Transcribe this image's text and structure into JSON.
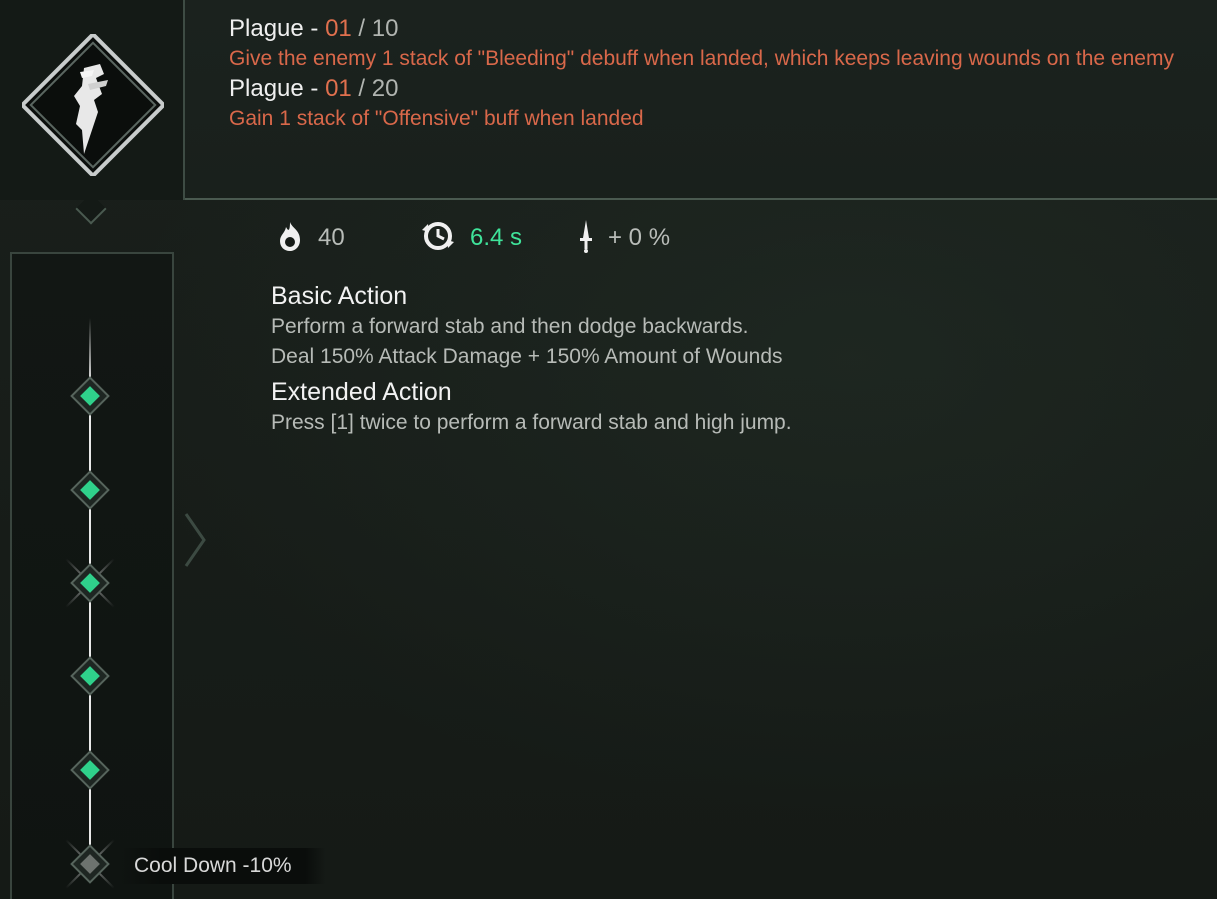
{
  "header": {
    "effects": [
      {
        "name": "Plague",
        "separator": " - ",
        "level": "01",
        "max": "10",
        "description": "Give the enemy 1 stack of \"Bleeding\" debuff when landed, which keeps leaving wounds on the enemy"
      },
      {
        "name": "Plague",
        "separator": " - ",
        "level": "01",
        "max": "20",
        "description": "Gain 1 stack of \"Offensive\" buff when landed"
      }
    ],
    "skill_icon": "dagger-icon"
  },
  "stats": {
    "cost": {
      "icon": "flame-icon",
      "value": "40"
    },
    "cooldown": {
      "icon": "cooldown-clock-icon",
      "value": "6.4 s"
    },
    "damage": {
      "icon": "sword-icon",
      "value": "+ 0 %"
    }
  },
  "actions": {
    "basic_title": "Basic Action",
    "basic_lines": [
      "Perform a forward stab and then dodge backwards.",
      "Deal 150% Attack Damage + 150% Amount of Wounds"
    ],
    "extended_title": "Extended Action",
    "extended_lines": [
      "Press [1] twice to perform a forward stab and high jump."
    ]
  },
  "rail": {
    "bonus_label": "Cool Down -10%"
  },
  "colors": {
    "accent_green": "#2fd18b",
    "cooldown_green": "#3fe39a",
    "plague_orange": "#d9684a"
  }
}
